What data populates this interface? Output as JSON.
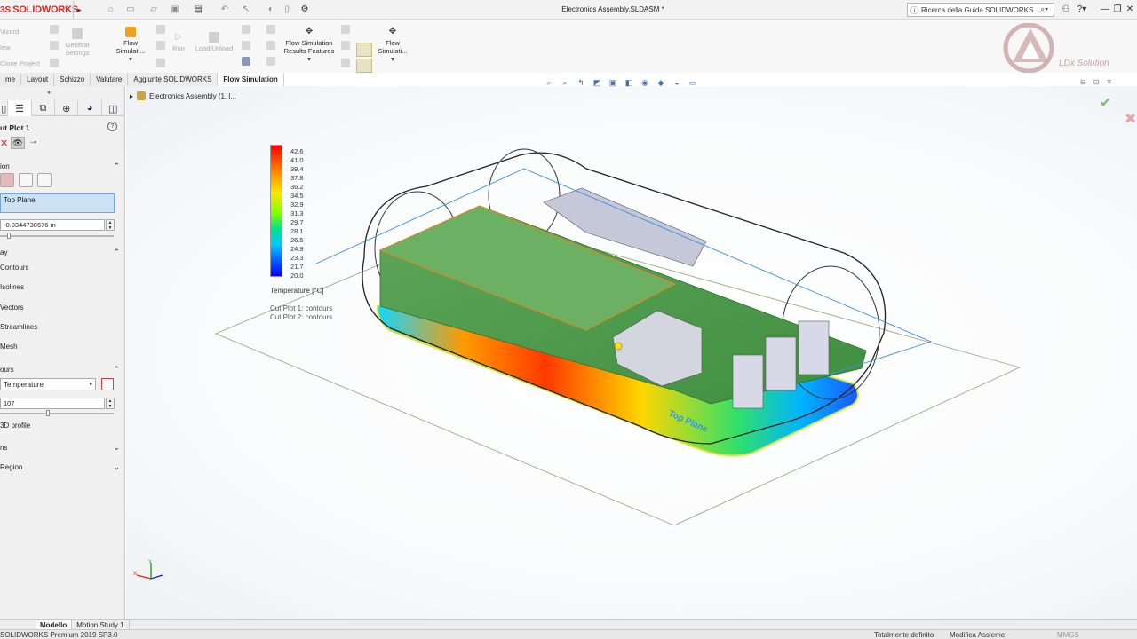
{
  "app": {
    "brand": "SOLIDWORKS",
    "document_title": "Electronics Assembly.SLDASM *",
    "help_search_placeholder": "Ricerca della Guida SOLIDWORKS"
  },
  "command_manager": {
    "left_dim_items": [
      "Vizard",
      "Iew",
      "Clone Project"
    ],
    "general_settings": "General\nSettings",
    "flow_sim_1": "Flow\nSimulati...",
    "run": "Run",
    "load_unload": "Load/Unload",
    "results_features": "Flow Simulation\nResults Features",
    "flow_sim_2": "Flow\nSimulati...",
    "watermark_text": "LDx Solution"
  },
  "tabs": [
    {
      "label": "me",
      "active": false
    },
    {
      "label": "Layout",
      "active": false
    },
    {
      "label": "Schizzo",
      "active": false
    },
    {
      "label": "Valutare",
      "active": false
    },
    {
      "label": "Aggiunte SOLIDWORKS",
      "active": false
    },
    {
      "label": "Flow Simulation",
      "active": true
    }
  ],
  "tree": {
    "root_label": "Electronics Assembly  (1. l..."
  },
  "property_manager": {
    "title": "ut Plot 1",
    "section_selection": "ion",
    "plane_value": "Top Plane",
    "offset_value": "-0.0344730676 m",
    "section_display": "ay",
    "display_items": [
      "Contours",
      "Isolines",
      "Vectors",
      "Streamlines",
      "Mesh"
    ],
    "section_contours": "ours",
    "parameter": "Temperature",
    "levels": "107",
    "profile_3d": "3D profile",
    "section_options": "ns",
    "section_region": "Region"
  },
  "legend": {
    "ticks": [
      "42.6",
      "41.0",
      "39.4",
      "37.8",
      "36.2",
      "34.5",
      "32.9",
      "31.3",
      "29.7",
      "28.1",
      "26.5",
      "24.9",
      "23.3",
      "21.7",
      "20.0"
    ],
    "title": "Temperature [°C]",
    "cut_plot_1": "Cut Plot 1: contours",
    "cut_plot_2": "Cut Plot 2: contours",
    "colors": {
      "max": "#ff0000",
      "mid": "#7fff00",
      "min": "#0000ff"
    }
  },
  "model_label": "Top Plane",
  "bottom_tabs": [
    {
      "label": "Modello",
      "active": true
    },
    {
      "label": "Motion Study 1",
      "active": false
    }
  ],
  "status": {
    "version": "SOLIDWORKS Premium 2019 SP3.0",
    "defined": "Totalmente definito",
    "mode": "Modifica Assieme",
    "units": "MMGS"
  }
}
